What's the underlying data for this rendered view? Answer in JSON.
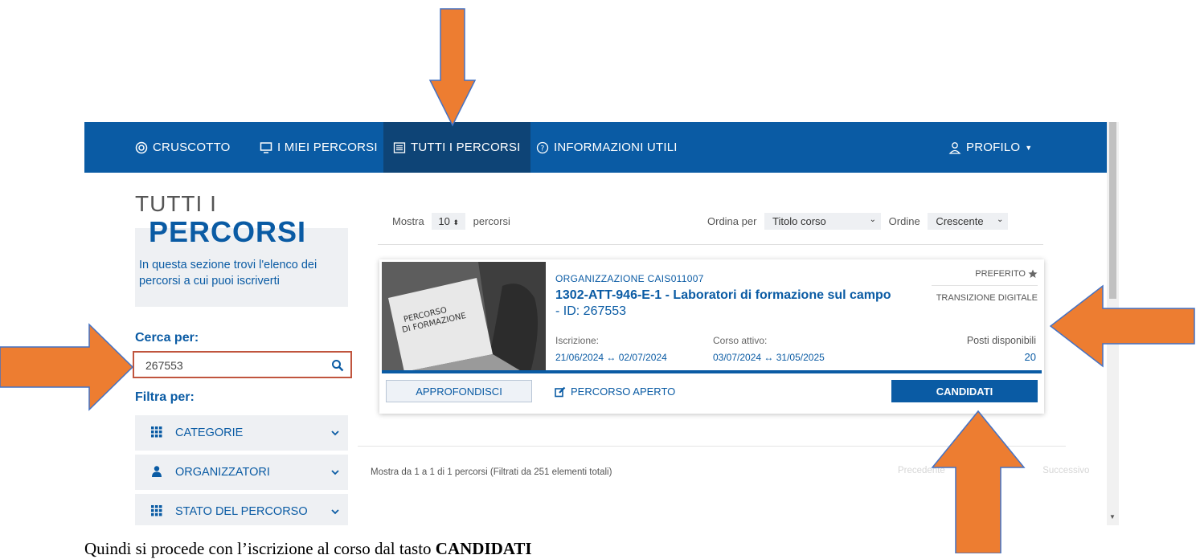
{
  "nav": {
    "items": [
      {
        "label": "CRUSCOTTO",
        "icon": "target-icon"
      },
      {
        "label": "I MIEI PERCORSI",
        "icon": "monitor-icon"
      },
      {
        "label": "TUTTI I PERCORSI",
        "icon": "list-icon",
        "active": true
      },
      {
        "label": "INFORMAZIONI UTILI",
        "icon": "help-circle-icon"
      }
    ],
    "profile": "PROFILO"
  },
  "sidebar": {
    "title_line1": "TUTTI I",
    "title_line2": "PERCORSI",
    "description": "In questa sezione trovi l'elenco dei percorsi a cui puoi iscriverti",
    "search_label": "Cerca per:",
    "search_value": "267553",
    "filter_label": "Filtra per:",
    "filters": [
      "CATEGORIE",
      "ORGANIZZATORI",
      "STATO DEL PERCORSO"
    ]
  },
  "toolbar": {
    "show_prefix": "Mostra",
    "show_value": "10",
    "show_suffix": "percorsi",
    "sort_label": "Ordina per",
    "sort_value": "Titolo corso",
    "order_label": "Ordine",
    "order_value": "Crescente"
  },
  "course": {
    "image_text_line1": "PERCORSO",
    "image_text_line2": "DI FORMAZIONE",
    "organization": "ORGANIZZAZIONE CAIS011007",
    "title": "1302-ATT-946-E-1 - Laboratori di formazione sul campo",
    "id_text": " - ID: 267553",
    "favorite": "PREFERITO",
    "tag": "TRANSIZIONE DIGITALE",
    "iscrizione_label": "Iscrizione:",
    "iscrizione_value": "21/06/2024 ↔ 02/07/2024",
    "attivo_label": "Corso attivo:",
    "attivo_value": "03/07/2024 ↔ 31/05/2025",
    "posti_label": "Posti disponibili",
    "posti_value": "20",
    "btn_details": "APPROFONDISCI",
    "status": "PERCORSO APERTO",
    "btn_apply": "CANDIDATI"
  },
  "footer": {
    "summary": "Mostra da 1 a 1 di 1 percorsi (Filtrati da 251 elementi totali)",
    "prev": "Precedente",
    "next": "Successivo"
  },
  "caption": {
    "text": "Quindi si procede con l’iscrizione al corso dal tasto ",
    "bold": "CANDIDATI"
  },
  "colors": {
    "brand": "#0a5ba4",
    "nav_active": "#0e4476",
    "arrow": "#ed7d31",
    "search_border": "#c0553e"
  }
}
